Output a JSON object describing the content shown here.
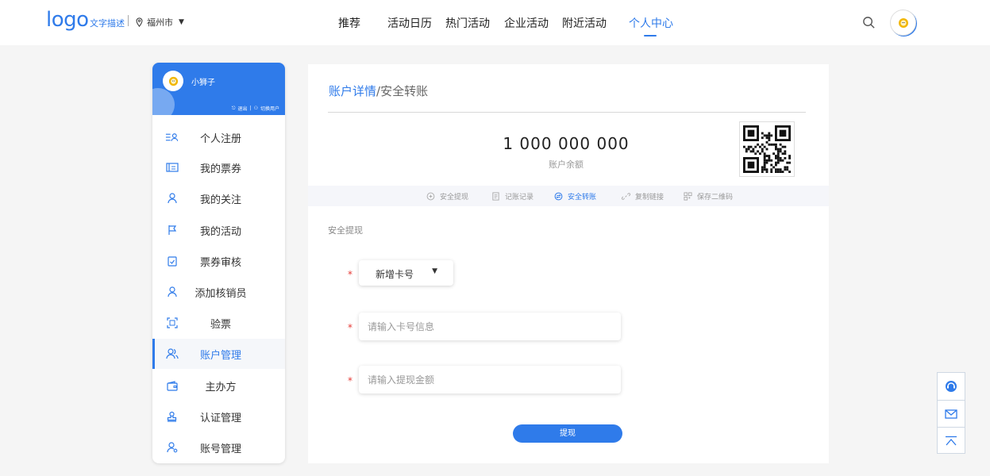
{
  "header": {
    "logo": "logo",
    "logo_desc": "文字描述",
    "city": "福州市",
    "nav": [
      "推荐",
      "活动日历",
      "热门活动",
      "企业活动",
      "附近活动",
      "个人中心"
    ],
    "active_nav": "个人中心",
    "accent": "#2f7bea"
  },
  "sidebar": {
    "user_name": "小狮子",
    "logout": "退出",
    "switch_user": "切换用户",
    "items": [
      {
        "label": "个人注册",
        "icon": "person-list-icon"
      },
      {
        "label": "我的票券",
        "icon": "ticket-icon"
      },
      {
        "label": "我的关注",
        "icon": "user-icon"
      },
      {
        "label": "我的活动",
        "icon": "flag-icon"
      },
      {
        "label": "票券审核",
        "icon": "clipboard-check-icon"
      },
      {
        "label": "添加核销员",
        "icon": "user-add-icon"
      },
      {
        "label": "验票",
        "icon": "scan-icon"
      },
      {
        "label": "账户管理",
        "icon": "users-icon"
      },
      {
        "label": "主办方",
        "icon": "wallet-icon"
      },
      {
        "label": "认证管理",
        "icon": "stamp-icon"
      },
      {
        "label": "账号管理",
        "icon": "user-gear-icon"
      }
    ],
    "active_item": "账户管理"
  },
  "main": {
    "breadcrumb_parent": "账户详情",
    "breadcrumb_sep": "/",
    "breadcrumb_current": "安全转账",
    "balance": "1 000 000 000",
    "balance_label": "账户余额",
    "tabs": [
      {
        "label": "安全提现",
        "icon": "shield-icon"
      },
      {
        "label": "记账记录",
        "icon": "record-icon"
      },
      {
        "label": "安全转账",
        "icon": "transfer-icon"
      },
      {
        "label": "复制链接",
        "icon": "link-icon"
      },
      {
        "label": "保存二维码",
        "icon": "qrcode-icon"
      }
    ],
    "active_tab": "安全转账",
    "section_title": "安全提现",
    "required_mark": "*",
    "card_select": "新增卡号",
    "card_input_placeholder": "请输入卡号信息",
    "amount_input_placeholder": "请输入提现金额",
    "submit": "提现"
  },
  "float_tools": [
    "customer-service-icon",
    "mail-icon",
    "back-to-top-icon"
  ]
}
